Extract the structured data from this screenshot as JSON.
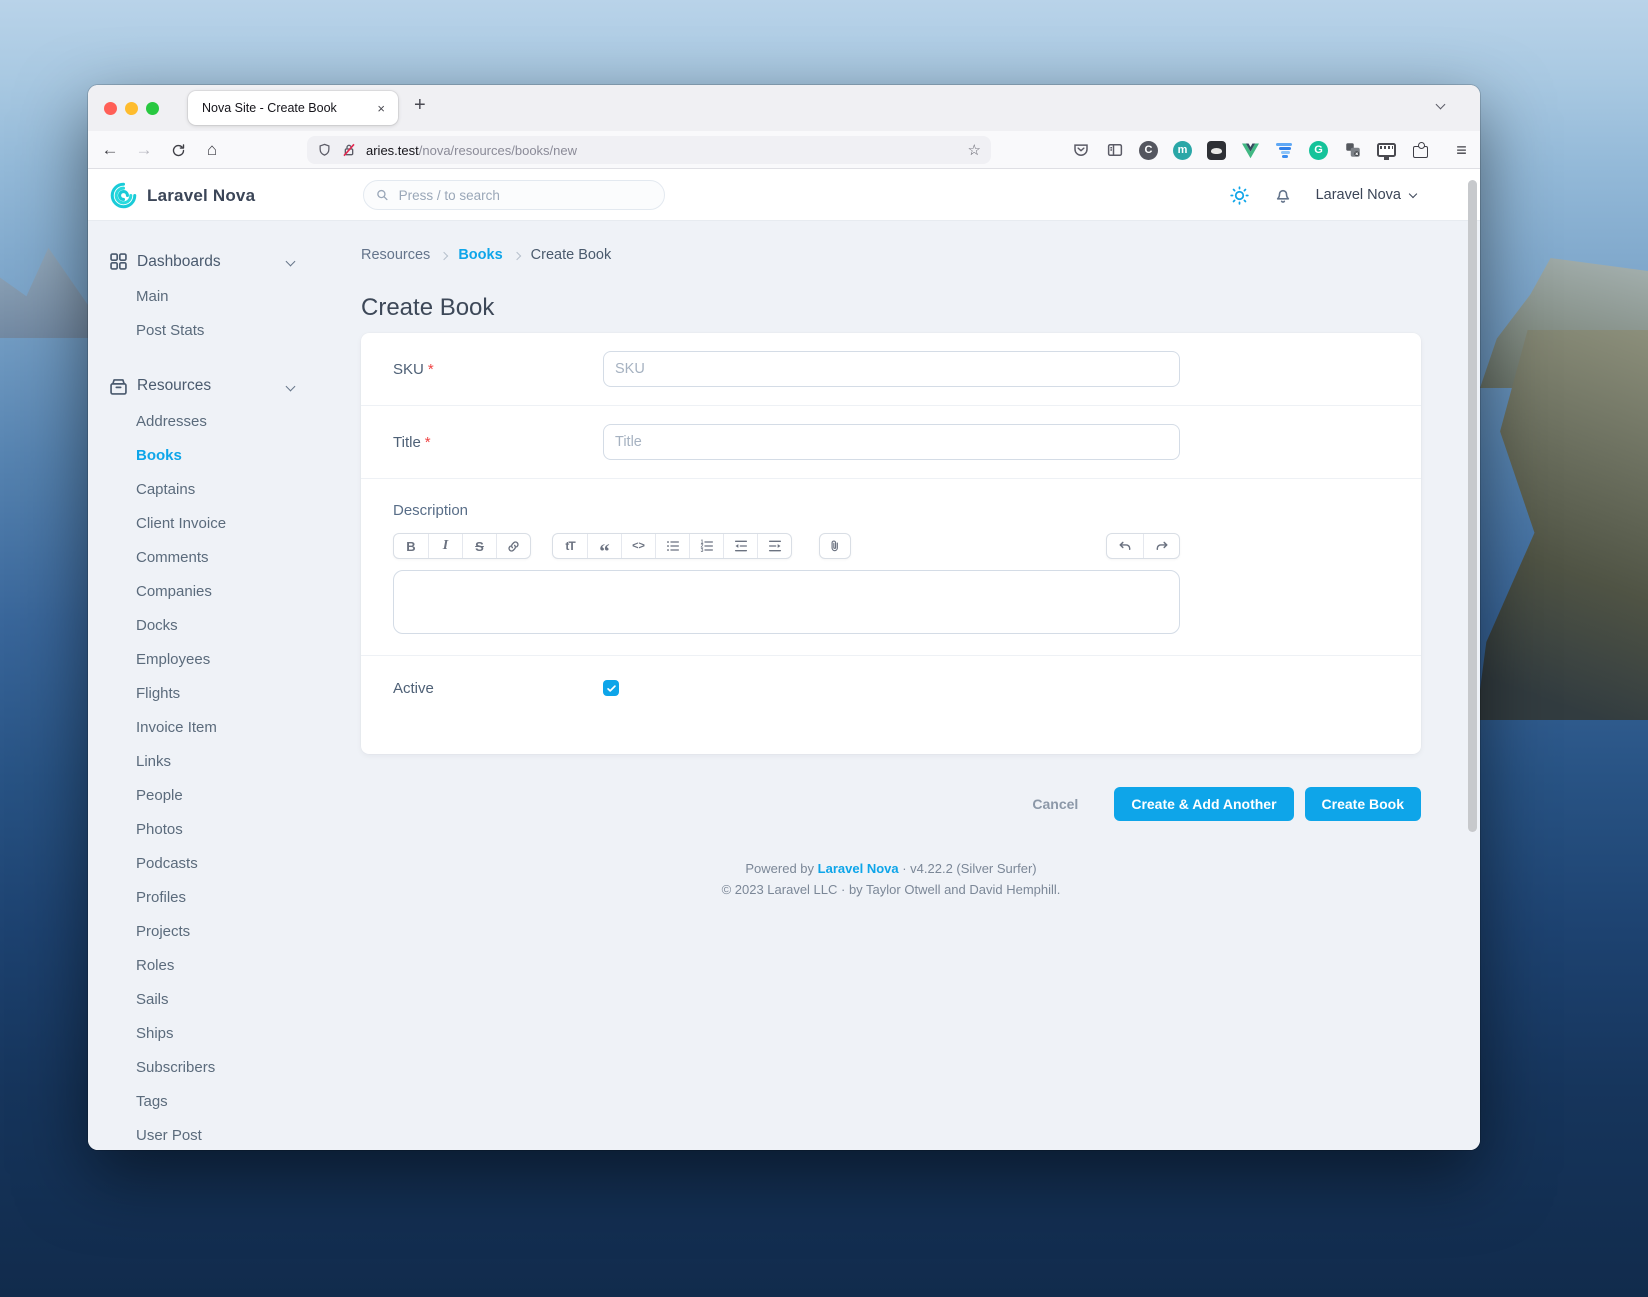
{
  "browser": {
    "tab_title": "Nova Site - Create Book",
    "url_host": "aries.test",
    "url_path": "/nova/resources/books/new"
  },
  "icons": {
    "back": "←",
    "forward": "→",
    "home": "⌂",
    "star": "☆",
    "plus": "+",
    "close": "×",
    "menu": "≡",
    "colorzilla": "C",
    "mastodon": "m",
    "vue": "V",
    "grammarly": "G",
    "bold": "B",
    "italic": "I",
    "strike": "S",
    "heading": "tT",
    "quote": "“",
    "code": "<>"
  },
  "nova": {
    "brand": "Laravel Nova",
    "search_placeholder": "Press / to search",
    "user_menu": "Laravel Nova",
    "colors": {
      "primary": "#0ea5e9"
    },
    "sidebar": {
      "dashboards": {
        "label": "Dashboards",
        "items": [
          {
            "label": "Main"
          },
          {
            "label": "Post Stats"
          }
        ]
      },
      "resources": {
        "label": "Resources",
        "items": [
          {
            "label": "Addresses"
          },
          {
            "label": "Books",
            "active": true
          },
          {
            "label": "Captains"
          },
          {
            "label": "Client Invoice"
          },
          {
            "label": "Comments"
          },
          {
            "label": "Companies"
          },
          {
            "label": "Docks"
          },
          {
            "label": "Employees"
          },
          {
            "label": "Flights"
          },
          {
            "label": "Invoice Item"
          },
          {
            "label": "Links"
          },
          {
            "label": "People"
          },
          {
            "label": "Photos"
          },
          {
            "label": "Podcasts"
          },
          {
            "label": "Profiles"
          },
          {
            "label": "Projects"
          },
          {
            "label": "Roles"
          },
          {
            "label": "Sails"
          },
          {
            "label": "Ships"
          },
          {
            "label": "Subscribers"
          },
          {
            "label": "Tags"
          },
          {
            "label": "User Post"
          }
        ]
      }
    },
    "breadcrumb": {
      "root": "Resources",
      "parent": "Books",
      "current": "Create Book"
    },
    "page_title": "Create Book",
    "form": {
      "sku_label": "SKU",
      "sku_placeholder": "SKU",
      "title_label": "Title",
      "title_placeholder": "Title",
      "required_mark": "*",
      "description_label": "Description",
      "active_label": "Active",
      "active_checked": true
    },
    "actions": {
      "cancel": "Cancel",
      "create_add": "Create & Add Another",
      "create": "Create Book"
    },
    "footer": {
      "powered": "Powered by",
      "brand": "Laravel Nova",
      "version": "· v4.22.2 (Silver Surfer)",
      "copyright": "© 2023 Laravel LLC · by Taylor Otwell and David Hemphill."
    }
  }
}
